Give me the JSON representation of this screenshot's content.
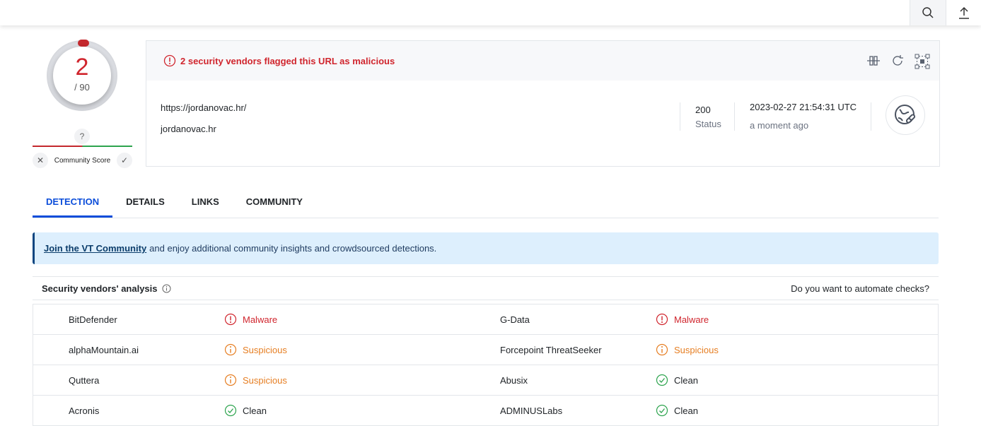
{
  "topbar": {
    "search_icon": "search-icon",
    "upload_icon": "upload-icon"
  },
  "score": {
    "detections": "2",
    "total": "/ 90",
    "community_question": "?",
    "community_label": "Community Score"
  },
  "summary": {
    "title": "2 security vendors flagged this URL as malicious",
    "url": "https://jordanovac.hr/",
    "domain": "jordanovac.hr",
    "status_code": "200",
    "status_label": "Status",
    "date": "2023-02-27 21:54:31 UTC",
    "relative_time": "a moment ago"
  },
  "tabs": [
    {
      "label": "DETECTION"
    },
    {
      "label": "DETAILS"
    },
    {
      "label": "LINKS"
    },
    {
      "label": "COMMUNITY"
    }
  ],
  "banner": {
    "link": "Join the VT Community",
    "text": "and enjoy additional community insights and crowdsourced detections."
  },
  "analysis": {
    "title": "Security vendors' analysis",
    "automate": "Do you want to automate checks?"
  },
  "vendors": [
    [
      {
        "name": "BitDefender",
        "result": "Malware",
        "type": "malicious"
      },
      {
        "name": "G-Data",
        "result": "Malware",
        "type": "malicious"
      }
    ],
    [
      {
        "name": "alphaMountain.ai",
        "result": "Suspicious",
        "type": "suspicious"
      },
      {
        "name": "Forcepoint ThreatSeeker",
        "result": "Suspicious",
        "type": "suspicious"
      }
    ],
    [
      {
        "name": "Quttera",
        "result": "Suspicious",
        "type": "suspicious"
      },
      {
        "name": "Abusix",
        "result": "Clean",
        "type": "clean"
      }
    ],
    [
      {
        "name": "Acronis",
        "result": "Clean",
        "type": "clean"
      },
      {
        "name": "ADMINUSLabs",
        "result": "Clean",
        "type": "clean"
      }
    ]
  ],
  "colors": {
    "malicious": "#d0252d",
    "suspicious": "#e67e22",
    "clean": "#2da44e",
    "accent": "#0b4dda"
  }
}
